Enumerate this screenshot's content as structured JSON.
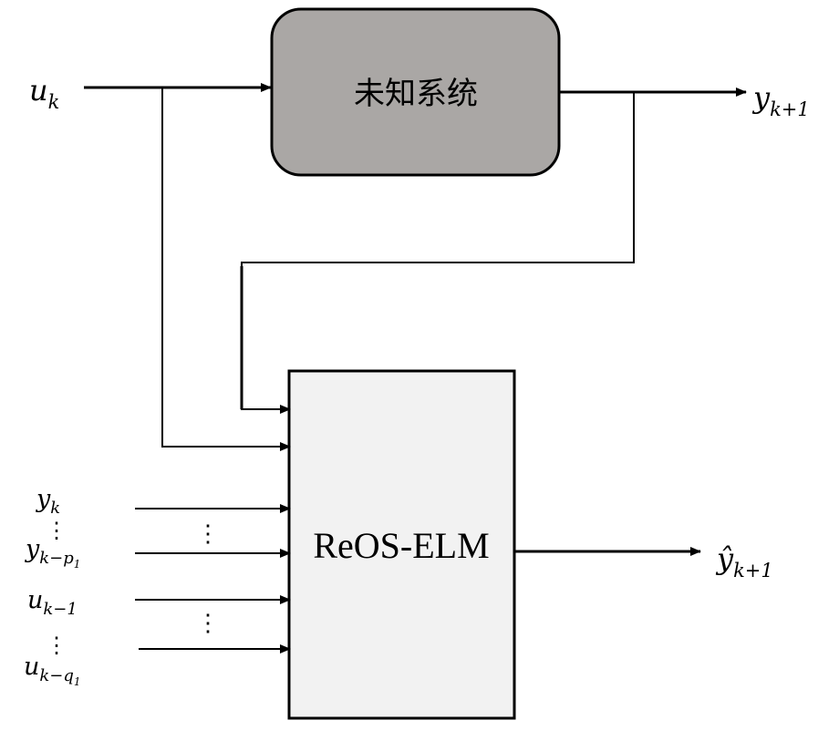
{
  "blocks": {
    "unknown_system": {
      "label": "未知系统",
      "fill": "#aaa7a5"
    },
    "model": {
      "label": "ReOS-ELM",
      "fill": "#f2f2f2"
    }
  },
  "signals": {
    "u_k": {
      "base": "u",
      "sub": "k"
    },
    "y_k1": {
      "base": "y",
      "sub": "k+1"
    },
    "y_hat_k1": {
      "base": "ŷ",
      "sub": "k+1"
    },
    "y_k": {
      "base": "y",
      "sub": "k"
    },
    "y_k_p1": {
      "base": "y",
      "sub": "k−p",
      "subsub": "1"
    },
    "u_k_1": {
      "base": "u",
      "sub": "k−1"
    },
    "u_k_q1": {
      "base": "u",
      "sub": "k−q",
      "subsub": "1"
    }
  },
  "ellipsis": "⋮",
  "colors": {
    "line": "#000000",
    "system_fill": "#aaa7a5",
    "model_fill": "#f2f2f2"
  }
}
